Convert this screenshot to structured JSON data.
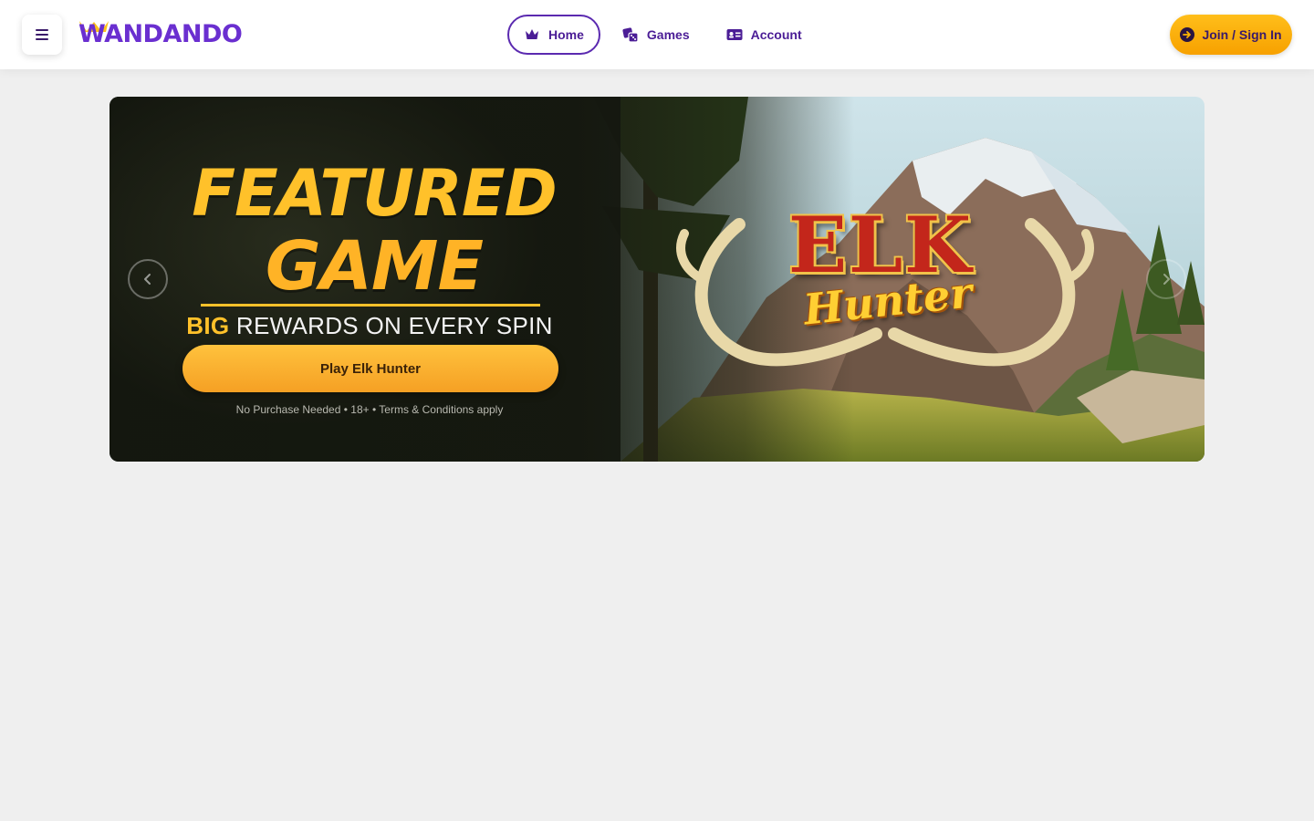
{
  "header": {
    "brand": "WANDANDO",
    "nav": [
      {
        "label": "Home",
        "icon": "crown-icon",
        "active": true
      },
      {
        "label": "Games",
        "icon": "dice-icon",
        "active": false
      },
      {
        "label": "Account",
        "icon": "id-card-icon",
        "active": false
      }
    ],
    "join_label": "Join / Sign In",
    "join_icon": "arrow-right-circle-icon"
  },
  "banner": {
    "headline_line1": "FEATURED",
    "headline_line2": "GAME",
    "tagline_big": "BIG",
    "tagline_rest": "REWARDS ON EVERY SPIN",
    "play_label": "Play Elk Hunter",
    "fine_print": "No Purchase Needed • 18+ •  Terms & Conditions apply",
    "game_title_1": "ELK",
    "game_title_2": "Hunter"
  },
  "colors": {
    "brand_purple": "#6a2fd0",
    "nav_text": "#4b1d96",
    "cta_yellow": "#ffb400",
    "page_bg": "#efefef"
  }
}
